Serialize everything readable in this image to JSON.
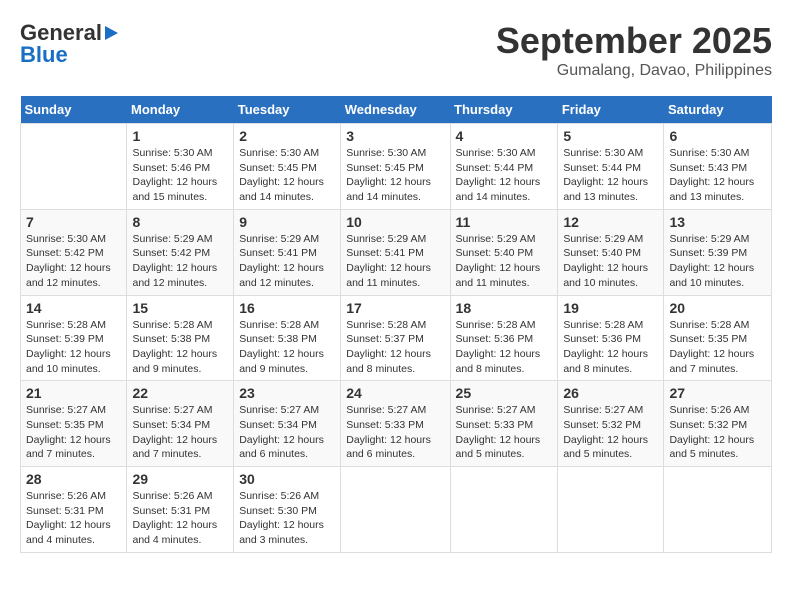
{
  "header": {
    "logo_general": "General",
    "logo_blue": "Blue",
    "month": "September 2025",
    "location": "Gumalang, Davao, Philippines"
  },
  "days_of_week": [
    "Sunday",
    "Monday",
    "Tuesday",
    "Wednesday",
    "Thursday",
    "Friday",
    "Saturday"
  ],
  "weeks": [
    [
      {
        "day": "",
        "info": ""
      },
      {
        "day": "1",
        "info": "Sunrise: 5:30 AM\nSunset: 5:46 PM\nDaylight: 12 hours\nand 15 minutes."
      },
      {
        "day": "2",
        "info": "Sunrise: 5:30 AM\nSunset: 5:45 PM\nDaylight: 12 hours\nand 14 minutes."
      },
      {
        "day": "3",
        "info": "Sunrise: 5:30 AM\nSunset: 5:45 PM\nDaylight: 12 hours\nand 14 minutes."
      },
      {
        "day": "4",
        "info": "Sunrise: 5:30 AM\nSunset: 5:44 PM\nDaylight: 12 hours\nand 14 minutes."
      },
      {
        "day": "5",
        "info": "Sunrise: 5:30 AM\nSunset: 5:44 PM\nDaylight: 12 hours\nand 13 minutes."
      },
      {
        "day": "6",
        "info": "Sunrise: 5:30 AM\nSunset: 5:43 PM\nDaylight: 12 hours\nand 13 minutes."
      }
    ],
    [
      {
        "day": "7",
        "info": "Sunrise: 5:30 AM\nSunset: 5:42 PM\nDaylight: 12 hours\nand 12 minutes."
      },
      {
        "day": "8",
        "info": "Sunrise: 5:29 AM\nSunset: 5:42 PM\nDaylight: 12 hours\nand 12 minutes."
      },
      {
        "day": "9",
        "info": "Sunrise: 5:29 AM\nSunset: 5:41 PM\nDaylight: 12 hours\nand 12 minutes."
      },
      {
        "day": "10",
        "info": "Sunrise: 5:29 AM\nSunset: 5:41 PM\nDaylight: 12 hours\nand 11 minutes."
      },
      {
        "day": "11",
        "info": "Sunrise: 5:29 AM\nSunset: 5:40 PM\nDaylight: 12 hours\nand 11 minutes."
      },
      {
        "day": "12",
        "info": "Sunrise: 5:29 AM\nSunset: 5:40 PM\nDaylight: 12 hours\nand 10 minutes."
      },
      {
        "day": "13",
        "info": "Sunrise: 5:29 AM\nSunset: 5:39 PM\nDaylight: 12 hours\nand 10 minutes."
      }
    ],
    [
      {
        "day": "14",
        "info": "Sunrise: 5:28 AM\nSunset: 5:39 PM\nDaylight: 12 hours\nand 10 minutes."
      },
      {
        "day": "15",
        "info": "Sunrise: 5:28 AM\nSunset: 5:38 PM\nDaylight: 12 hours\nand 9 minutes."
      },
      {
        "day": "16",
        "info": "Sunrise: 5:28 AM\nSunset: 5:38 PM\nDaylight: 12 hours\nand 9 minutes."
      },
      {
        "day": "17",
        "info": "Sunrise: 5:28 AM\nSunset: 5:37 PM\nDaylight: 12 hours\nand 8 minutes."
      },
      {
        "day": "18",
        "info": "Sunrise: 5:28 AM\nSunset: 5:36 PM\nDaylight: 12 hours\nand 8 minutes."
      },
      {
        "day": "19",
        "info": "Sunrise: 5:28 AM\nSunset: 5:36 PM\nDaylight: 12 hours\nand 8 minutes."
      },
      {
        "day": "20",
        "info": "Sunrise: 5:28 AM\nSunset: 5:35 PM\nDaylight: 12 hours\nand 7 minutes."
      }
    ],
    [
      {
        "day": "21",
        "info": "Sunrise: 5:27 AM\nSunset: 5:35 PM\nDaylight: 12 hours\nand 7 minutes."
      },
      {
        "day": "22",
        "info": "Sunrise: 5:27 AM\nSunset: 5:34 PM\nDaylight: 12 hours\nand 7 minutes."
      },
      {
        "day": "23",
        "info": "Sunrise: 5:27 AM\nSunset: 5:34 PM\nDaylight: 12 hours\nand 6 minutes."
      },
      {
        "day": "24",
        "info": "Sunrise: 5:27 AM\nSunset: 5:33 PM\nDaylight: 12 hours\nand 6 minutes."
      },
      {
        "day": "25",
        "info": "Sunrise: 5:27 AM\nSunset: 5:33 PM\nDaylight: 12 hours\nand 5 minutes."
      },
      {
        "day": "26",
        "info": "Sunrise: 5:27 AM\nSunset: 5:32 PM\nDaylight: 12 hours\nand 5 minutes."
      },
      {
        "day": "27",
        "info": "Sunrise: 5:26 AM\nSunset: 5:32 PM\nDaylight: 12 hours\nand 5 minutes."
      }
    ],
    [
      {
        "day": "28",
        "info": "Sunrise: 5:26 AM\nSunset: 5:31 PM\nDaylight: 12 hours\nand 4 minutes."
      },
      {
        "day": "29",
        "info": "Sunrise: 5:26 AM\nSunset: 5:31 PM\nDaylight: 12 hours\nand 4 minutes."
      },
      {
        "day": "30",
        "info": "Sunrise: 5:26 AM\nSunset: 5:30 PM\nDaylight: 12 hours\nand 3 minutes."
      },
      {
        "day": "",
        "info": ""
      },
      {
        "day": "",
        "info": ""
      },
      {
        "day": "",
        "info": ""
      },
      {
        "day": "",
        "info": ""
      }
    ]
  ]
}
